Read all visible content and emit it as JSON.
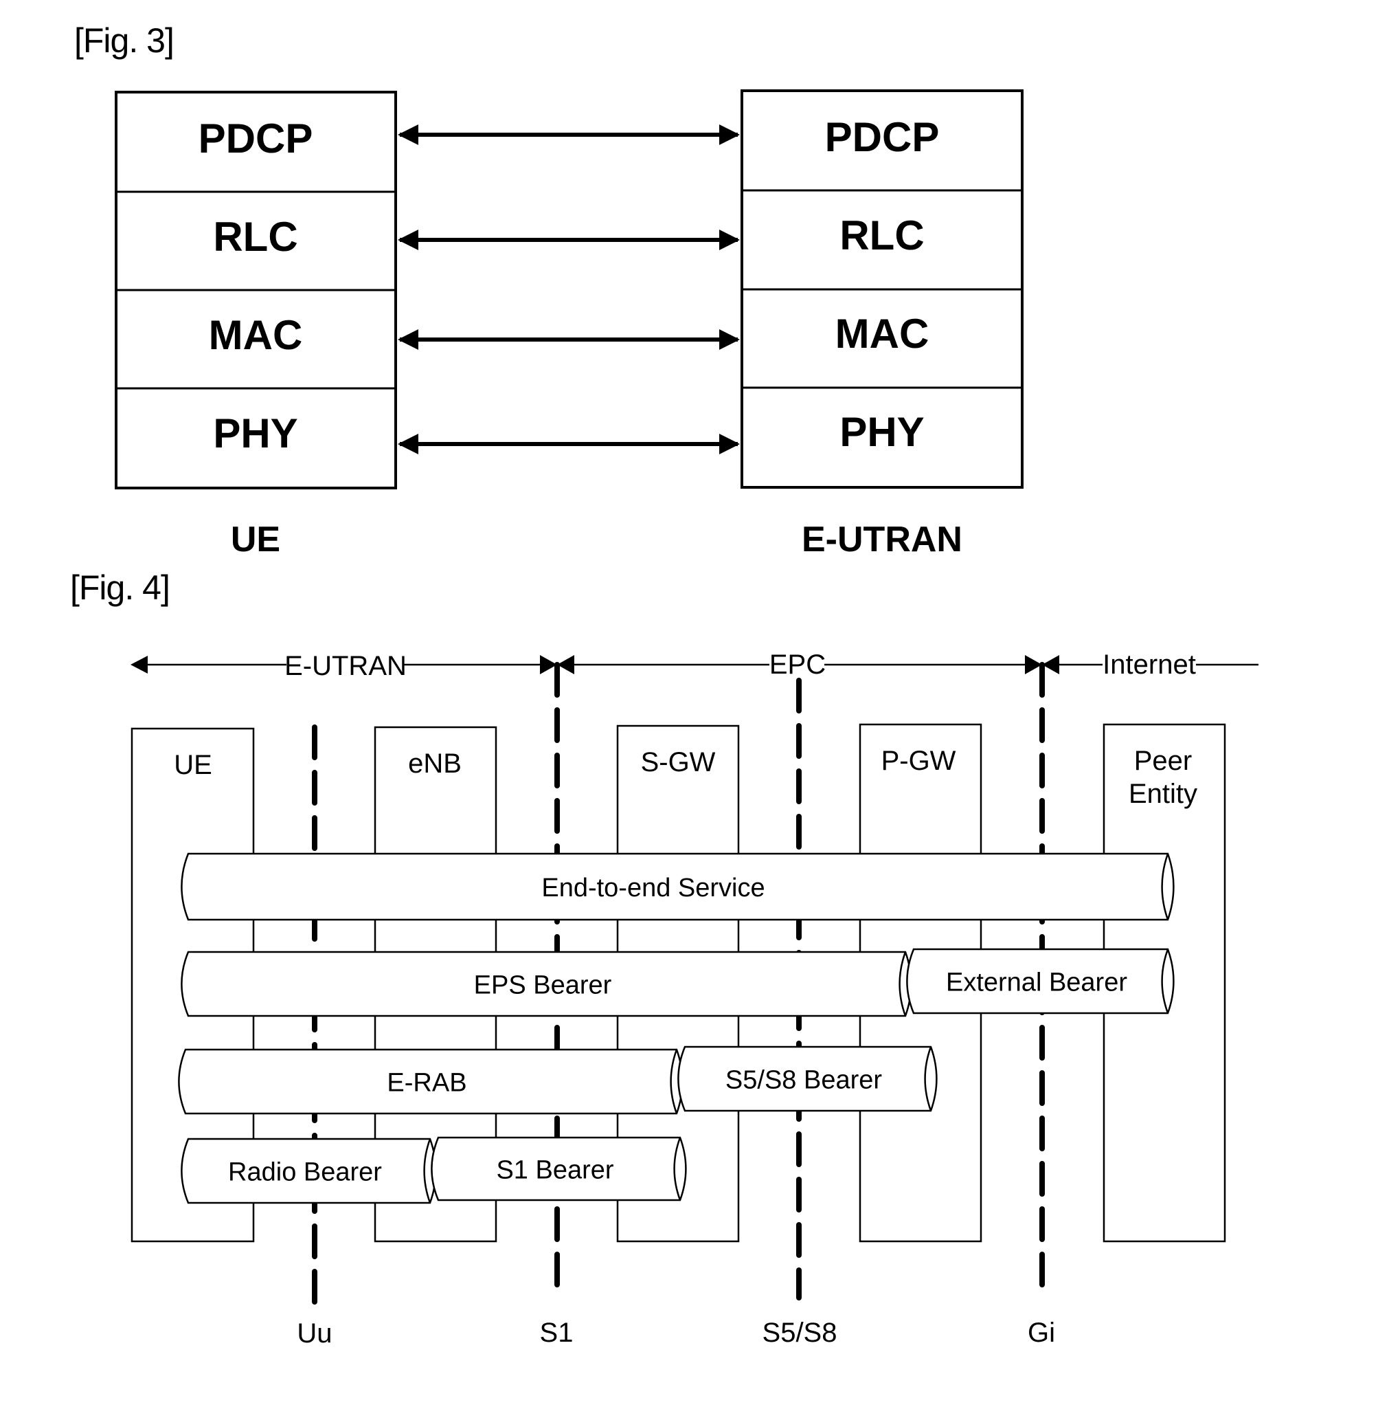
{
  "figures": {
    "fig3": {
      "label": "[Fig. 3]",
      "stacks": [
        {
          "node": "UE",
          "layers": [
            "PDCP",
            "RLC",
            "MAC",
            "PHY"
          ]
        },
        {
          "node": "E-UTRAN",
          "layers": [
            "PDCP",
            "RLC",
            "MAC",
            "PHY"
          ]
        }
      ],
      "peer_links": [
        "PDCP",
        "RLC",
        "MAC",
        "PHY"
      ]
    },
    "fig4": {
      "label": "[Fig. 4]",
      "domains": [
        "E-UTRAN",
        "EPC",
        "Internet"
      ],
      "entities": [
        "UE",
        "eNB",
        "S-GW",
        "P-GW",
        "Peer Entity"
      ],
      "interfaces": [
        "Uu",
        "S1",
        "S5/S8",
        "Gi"
      ],
      "bearers": [
        {
          "name": "End-to-end Service",
          "from": "UE",
          "to": "Peer Entity"
        },
        {
          "name": "EPS Bearer",
          "from": "UE",
          "to": "P-GW"
        },
        {
          "name": "External Bearer",
          "from": "P-GW",
          "to": "Peer Entity"
        },
        {
          "name": "E-RAB",
          "from": "UE",
          "to": "S-GW"
        },
        {
          "name": "S5/S8 Bearer",
          "from": "S-GW",
          "to": "P-GW"
        },
        {
          "name": "Radio Bearer",
          "from": "UE",
          "to": "eNB"
        },
        {
          "name": "S1 Bearer",
          "from": "eNB",
          "to": "S-GW"
        }
      ]
    }
  }
}
